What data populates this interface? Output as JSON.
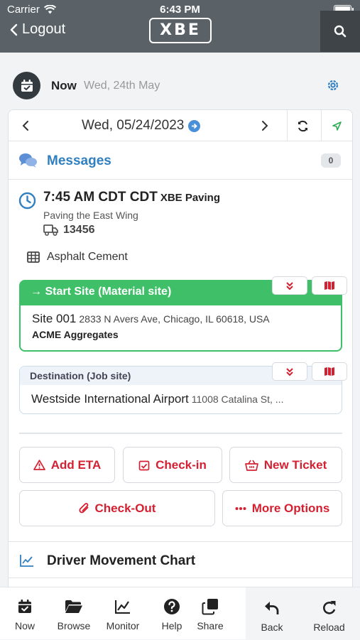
{
  "status": {
    "carrier": "Carrier",
    "time": "6:43 PM"
  },
  "nav": {
    "back_label": "Logout",
    "logo": "XBE"
  },
  "date_header": {
    "now_label": "Now",
    "date": "Wed, 24th May"
  },
  "date_nav": {
    "date": "Wed, 05/24/2023"
  },
  "messages": {
    "label": "Messages",
    "count": "0"
  },
  "job": {
    "time": "7:45 AM CDT CDT",
    "company": "XBE Paving",
    "description": "Paving the East Wing",
    "truck": "13456",
    "material": "Asphalt Cement"
  },
  "start_site": {
    "header": "Start Site (Material site)",
    "name": "Site 001",
    "address": "2833 N Avers Ave, Chicago, IL 60618, USA",
    "company": "ACME Aggregates"
  },
  "destination": {
    "header": "Destination (Job site)",
    "name": "Westside International Airport",
    "address": "11008 Catalina St, ..."
  },
  "actions": {
    "add_eta": "Add ETA",
    "check_in": "Check-in",
    "new_ticket": "New Ticket",
    "check_out": "Check-Out",
    "more_options": "More Options"
  },
  "chart_section": {
    "label": "Driver Movement Chart"
  },
  "tabs": [
    {
      "label": "Now",
      "icon": "calendar-check-icon"
    },
    {
      "label": "Browse",
      "icon": "folder-icon"
    },
    {
      "label": "Monitor",
      "icon": "chart-line-icon"
    },
    {
      "label": "Help",
      "icon": "help-icon"
    },
    {
      "label": "Share",
      "icon": "share-icon"
    },
    {
      "label": "Back",
      "icon": "undo-icon"
    },
    {
      "label": "Reload",
      "icon": "reload-icon"
    }
  ],
  "colors": {
    "header_bg": "#5a6268",
    "accent_blue": "#2f7fc1",
    "action_red": "#d42031",
    "start_green": "#3fbf68"
  }
}
